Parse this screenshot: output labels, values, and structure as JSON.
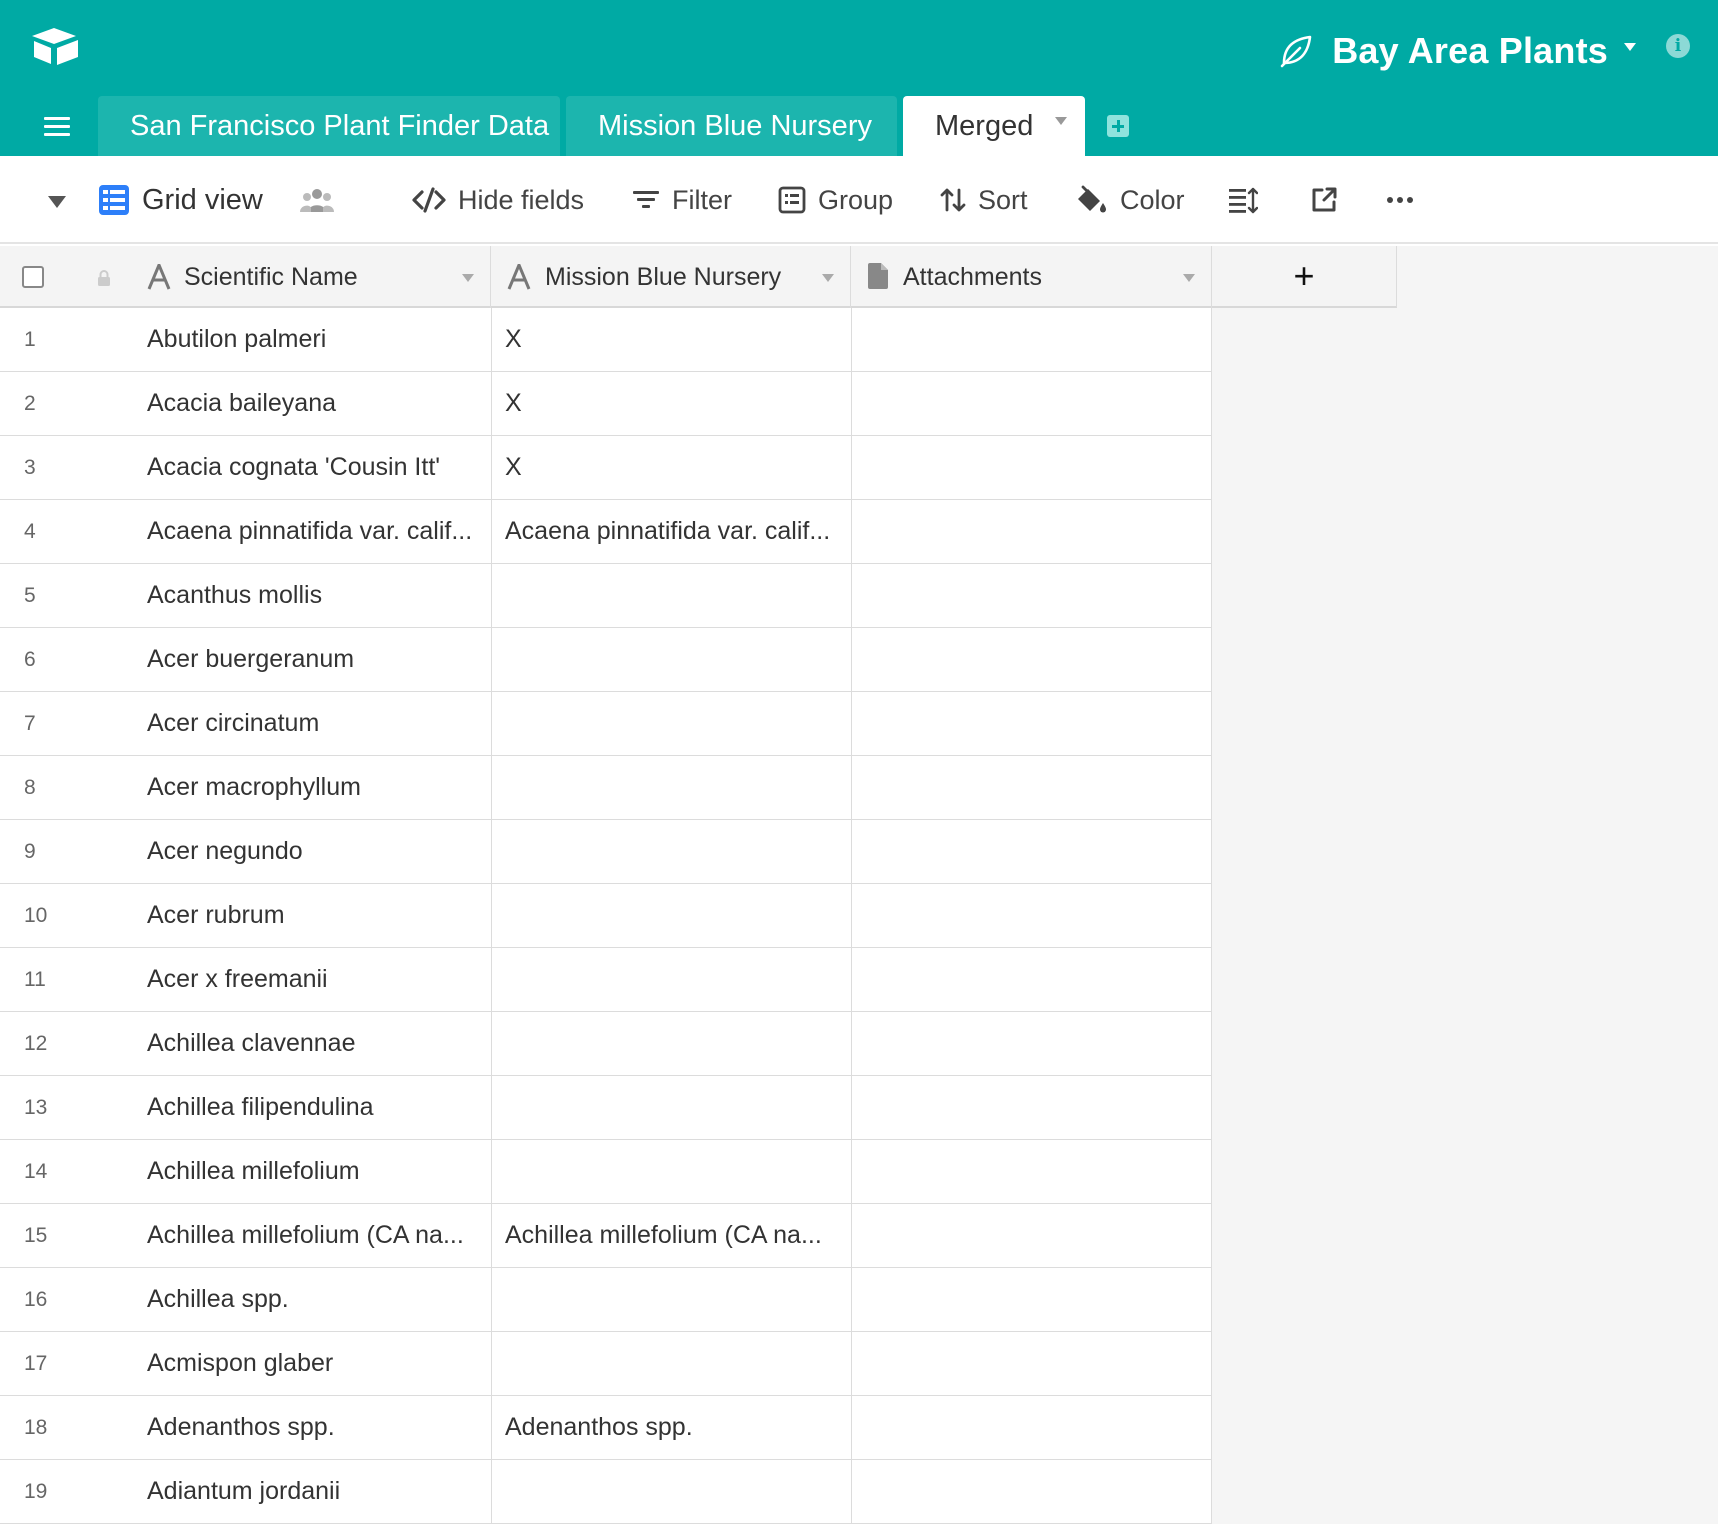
{
  "app": {
    "base_name": "Bay Area Plants",
    "info_label": "i"
  },
  "tabs": [
    {
      "label": "San Francisco Plant Finder Data",
      "active": false
    },
    {
      "label": "Mission Blue Nursery",
      "active": false
    },
    {
      "label": "Merged",
      "active": true
    }
  ],
  "toolbar": {
    "view_name": "Grid view",
    "hide_fields": "Hide fields",
    "filter": "Filter",
    "group": "Group",
    "sort": "Sort",
    "color": "Color"
  },
  "grid": {
    "add_field_label": "+",
    "columns": [
      {
        "label": "Scientific Name",
        "icon": "text-field-icon"
      },
      {
        "label": "Mission Blue Nursery",
        "icon": "text-field-icon"
      },
      {
        "label": "Attachments",
        "icon": "attachment-field-icon"
      }
    ],
    "rows": [
      {
        "num": "1",
        "name": "Abutilon palmeri",
        "mbn": "X",
        "att": ""
      },
      {
        "num": "2",
        "name": "Acacia baileyana",
        "mbn": "X",
        "att": ""
      },
      {
        "num": "3",
        "name": "Acacia cognata 'Cousin Itt'",
        "mbn": "X",
        "att": ""
      },
      {
        "num": "4",
        "name": "Acaena pinnatifida var. calif...",
        "mbn": "Acaena pinnatifida var. calif...",
        "att": ""
      },
      {
        "num": "5",
        "name": "Acanthus mollis",
        "mbn": "",
        "att": ""
      },
      {
        "num": "6",
        "name": "Acer buergeranum",
        "mbn": "",
        "att": ""
      },
      {
        "num": "7",
        "name": "Acer circinatum",
        "mbn": "",
        "att": ""
      },
      {
        "num": "8",
        "name": "Acer macrophyllum",
        "mbn": "",
        "att": ""
      },
      {
        "num": "9",
        "name": "Acer negundo",
        "mbn": "",
        "att": ""
      },
      {
        "num": "10",
        "name": "Acer rubrum",
        "mbn": "",
        "att": ""
      },
      {
        "num": "11",
        "name": "Acer x freemanii",
        "mbn": "",
        "att": ""
      },
      {
        "num": "12",
        "name": "Achillea clavennae",
        "mbn": "",
        "att": ""
      },
      {
        "num": "13",
        "name": "Achillea filipendulina",
        "mbn": "",
        "att": ""
      },
      {
        "num": "14",
        "name": "Achillea millefolium",
        "mbn": "",
        "att": ""
      },
      {
        "num": "15",
        "name": "Achillea millefolium (CA na...",
        "mbn": "Achillea millefolium (CA na...",
        "att": ""
      },
      {
        "num": "16",
        "name": "Achillea spp.",
        "mbn": "",
        "att": ""
      },
      {
        "num": "17",
        "name": "Acmispon glaber",
        "mbn": "",
        "att": ""
      },
      {
        "num": "18",
        "name": "Adenanthos spp.",
        "mbn": "Adenanthos spp.",
        "att": ""
      },
      {
        "num": "19",
        "name": "Adiantum jordanii",
        "mbn": "",
        "att": ""
      }
    ]
  },
  "colors": {
    "header_teal": "#00aaa4",
    "tab_inactive": "#1cb5ae",
    "view_icon_blue": "#2d7ff9"
  }
}
